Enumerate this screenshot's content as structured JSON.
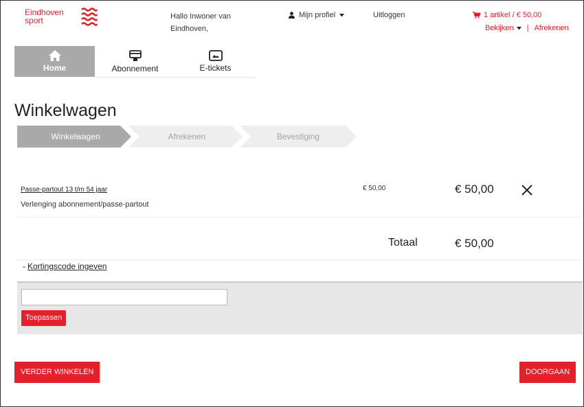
{
  "header": {
    "logo_line1": "Eindhoven",
    "logo_line2": "sport",
    "greeting": "Hallo Inwoner van Eindhoven,",
    "profile_label": "Mijn profiel",
    "logout_label": "Uitloggen",
    "cart_summary": "1 artikel / € 50,00",
    "view_label": "Bekijken",
    "checkout_link": "Afrekenen",
    "divider": "|",
    "brand_color": "#e4202a"
  },
  "nav": {
    "tabs": [
      {
        "label": "Home",
        "icon": "home-icon",
        "active": true
      },
      {
        "label": "Abonnement",
        "icon": "subscription-card-icon",
        "active": false
      },
      {
        "label": "E-tickets",
        "icon": "ticket-icon",
        "active": false
      }
    ]
  },
  "page": {
    "title": "Winkelwagen"
  },
  "steps": [
    {
      "label": "Winkelwagen",
      "active": true
    },
    {
      "label": "Afrekenen",
      "active": false
    },
    {
      "label": "Bevestiging",
      "active": false
    }
  ],
  "cart": {
    "items": [
      {
        "title": "Passe-partout 13 t/m 54 jaar",
        "subtitle": "Verlenging abonnement/passe-partout",
        "price": "€ 50,00",
        "total": "€ 50,00"
      }
    ],
    "total_label": "Totaal",
    "total_value": "€ 50,00"
  },
  "discount": {
    "toggle_symbol": "-",
    "toggle_label": "Kortingscode ingeven",
    "input_value": "",
    "apply_label": "Toepassen"
  },
  "actions": {
    "continue_shopping": "VERDER WINKELEN",
    "proceed": "DOORGAAN"
  }
}
